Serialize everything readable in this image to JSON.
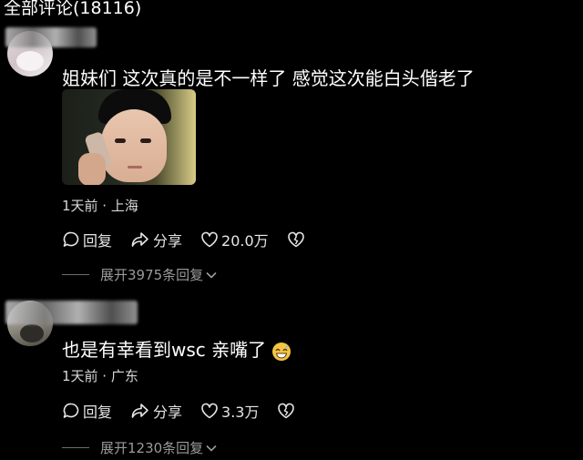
{
  "header": {
    "title": "全部评论(18116)"
  },
  "comments": [
    {
      "text": "姐妹们 这次真的是不一样了 感觉这次能白头偕老了",
      "time_location": "1天前 · 上海",
      "reply_label": "回复",
      "share_label": "分享",
      "likes": "20.0万",
      "expand_label": "展开3975条回复"
    },
    {
      "text": "也是有幸看到wsc 亲嘴了",
      "time_location": "1天前 · 广东",
      "reply_label": "回复",
      "share_label": "分享",
      "likes": "3.3万",
      "expand_label": "展开1230条回复"
    }
  ],
  "icons": [
    "chat-bubble-icon",
    "share-arrow-icon",
    "heart-icon",
    "broken-heart-icon",
    "chevron-down-icon",
    "grinning-sweat-emoji"
  ],
  "colors": {
    "background": "#000000",
    "text": "#ffffff",
    "secondary": "#9a9a9a"
  }
}
